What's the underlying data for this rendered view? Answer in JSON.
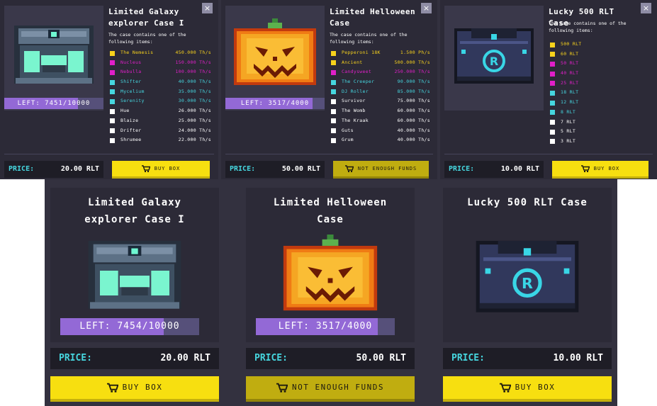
{
  "colors": {
    "card_bg": "#2c2a37",
    "accent_cyan": "#46d6df",
    "button_yellow": "#f7df10",
    "button_disabled": "#c0ad10",
    "progress_purple": "#9369d6",
    "common": "#ffffff",
    "rare": "#46d6df",
    "epic": "#e01fc8",
    "legendary": "#f7d21c"
  },
  "popups": [
    {
      "title": "Limited Galaxy explorer Case I",
      "close_icon": "×",
      "description": "The case contains one of the following items:",
      "left_text": "LEFT: 7451/10000",
      "left_fraction": 0.7451,
      "price_label": "PRICE:",
      "price_value": "20.00 RLT",
      "button_label": "BUY BOX",
      "button_enabled": true,
      "items": [
        {
          "name": "The Nemesis",
          "power": "450.000 Th/s",
          "rarity": "legendary"
        },
        {
          "name": "Nucleus",
          "power": "150.000 Th/s",
          "rarity": "epic"
        },
        {
          "name": "Nebulla",
          "power": "100.000 Th/s",
          "rarity": "epic"
        },
        {
          "name": "Shifter",
          "power": "40.000 Th/s",
          "rarity": "rare"
        },
        {
          "name": "Mycelium",
          "power": "35.000 Th/s",
          "rarity": "rare"
        },
        {
          "name": "Serenity",
          "power": "30.000 Th/s",
          "rarity": "rare"
        },
        {
          "name": "Hue",
          "power": "26.000 Th/s",
          "rarity": "common"
        },
        {
          "name": "Blaize",
          "power": "25.000 Th/s",
          "rarity": "common"
        },
        {
          "name": "Drifter",
          "power": "24.000 Th/s",
          "rarity": "common"
        },
        {
          "name": "Shrumee",
          "power": "22.000 Th/s",
          "rarity": "common"
        }
      ]
    },
    {
      "title": "Limited Helloween Case",
      "close_icon": "×",
      "description": "The case contains one of the following items:",
      "left_text": "LEFT: 3517/4000",
      "left_fraction": 0.879,
      "price_label": "PRICE:",
      "price_value": "50.00 RLT",
      "button_label": "NOT ENOUGH FUNDS",
      "button_enabled": false,
      "items": [
        {
          "name": "Pepperoni 18K",
          "power": "1.500 Ph/s",
          "rarity": "legendary"
        },
        {
          "name": "Ancient",
          "power": "500.000 Th/s",
          "rarity": "legendary"
        },
        {
          "name": "Candysweet",
          "power": "250.000 Th/s",
          "rarity": "epic"
        },
        {
          "name": "The Creeper",
          "power": "90.000 Th/s",
          "rarity": "rare"
        },
        {
          "name": "DJ Roller",
          "power": "85.000 Th/s",
          "rarity": "rare"
        },
        {
          "name": "Survivor",
          "power": "75.000 Th/s",
          "rarity": "common"
        },
        {
          "name": "The Womb",
          "power": "60.000 Th/s",
          "rarity": "common"
        },
        {
          "name": "The Kraak",
          "power": "60.000 Th/s",
          "rarity": "common"
        },
        {
          "name": "Guts",
          "power": "40.000 Th/s",
          "rarity": "common"
        },
        {
          "name": "Grum",
          "power": "40.000 Th/s",
          "rarity": "common"
        }
      ]
    },
    {
      "title": "Lucky 500 RLT Case",
      "close_icon": "×",
      "description": "The case contains one of the following items:",
      "price_label": "PRICE:",
      "price_value": "10.00 RLT",
      "button_label": "BUY BOX",
      "button_enabled": true,
      "items": [
        {
          "name": "500 RLT",
          "power": "",
          "rarity": "legendary"
        },
        {
          "name": "60 RLT",
          "power": "",
          "rarity": "legendary"
        },
        {
          "name": "50 RLT",
          "power": "",
          "rarity": "epic"
        },
        {
          "name": "40 RLT",
          "power": "",
          "rarity": "epic"
        },
        {
          "name": "25 RLT",
          "power": "",
          "rarity": "epic"
        },
        {
          "name": "18 RLT",
          "power": "",
          "rarity": "rare"
        },
        {
          "name": "12 RLT",
          "power": "",
          "rarity": "rare"
        },
        {
          "name": "8 RLT",
          "power": "",
          "rarity": "rare"
        },
        {
          "name": "7 RLT",
          "power": "",
          "rarity": "common"
        },
        {
          "name": "5 RLT",
          "power": "",
          "rarity": "common"
        },
        {
          "name": "3 RLT",
          "power": "",
          "rarity": "common"
        }
      ]
    }
  ],
  "cards": [
    {
      "title": "Limited Galaxy\nexplorer Case I",
      "image_icon": "galaxy-chest-icon",
      "left_text": "LEFT: 7454/10000",
      "left_fraction": 0.7454,
      "price_label": "PRICE:",
      "price_value": "20.00 RLT",
      "button_label": "BUY BOX",
      "button_enabled": true
    },
    {
      "title": "Limited Helloween\nCase",
      "image_icon": "pumpkin-chest-icon",
      "left_text": "LEFT: 3517/4000",
      "left_fraction": 0.879,
      "price_label": "PRICE:",
      "price_value": "50.00 RLT",
      "button_label": "NOT ENOUGH FUNDS",
      "button_enabled": false
    },
    {
      "title": "Lucky 500 RLT Case",
      "image_icon": "lucky-chest-icon",
      "price_label": "PRICE:",
      "price_value": "10.00 RLT",
      "button_label": "BUY BOX",
      "button_enabled": true
    }
  ]
}
